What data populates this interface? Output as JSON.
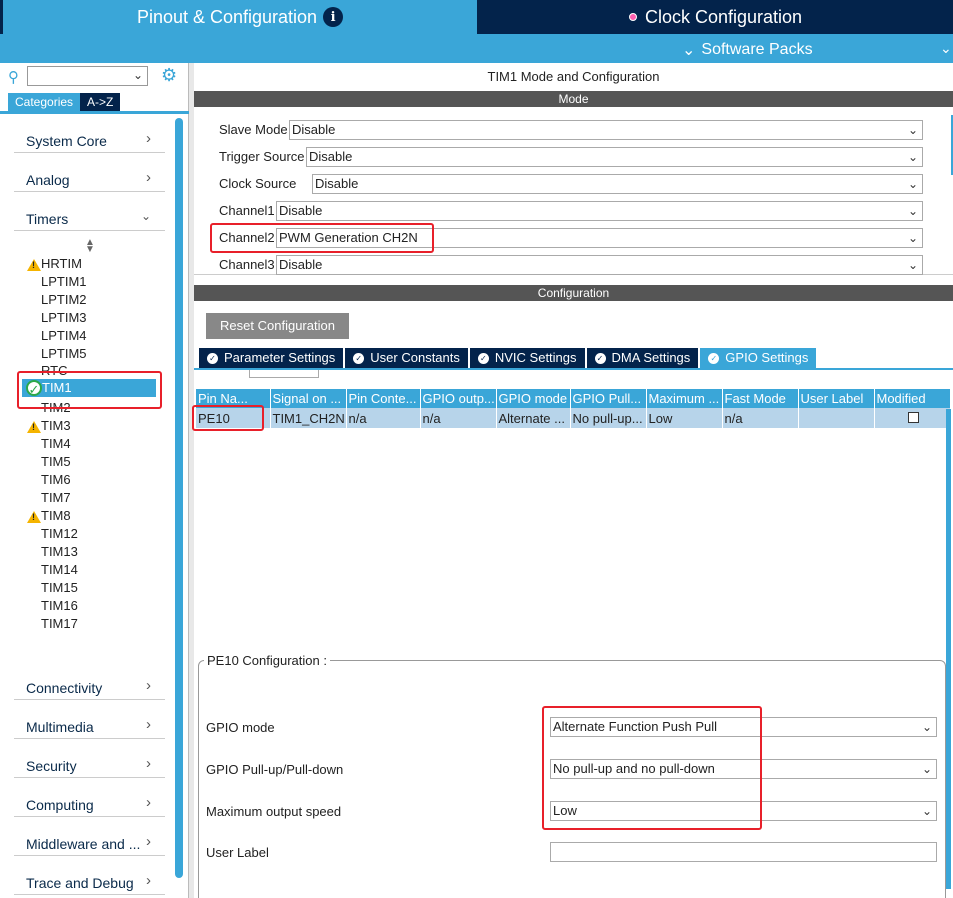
{
  "header": {
    "pinout_tab": "Pinout & Configuration",
    "clock_tab": "Clock Configuration",
    "software_packs": "Software Packs"
  },
  "sidebar": {
    "search": {
      "value": ""
    },
    "tabs": {
      "categories": "Categories",
      "az": "A->Z"
    },
    "categories_top": [
      "System Core",
      "Analog",
      "Timers"
    ],
    "timers": [
      "HRTIM",
      "LPTIM1",
      "LPTIM2",
      "LPTIM3",
      "LPTIM4",
      "LPTIM5",
      "RTC",
      "TIM1",
      "TIM2",
      "TIM3",
      "TIM4",
      "TIM5",
      "TIM6",
      "TIM7",
      "TIM8",
      "TIM12",
      "TIM13",
      "TIM14",
      "TIM15",
      "TIM16",
      "TIM17"
    ],
    "categories_bottom": [
      "Connectivity",
      "Multimedia",
      "Security",
      "Computing",
      "Middleware and ...",
      "Trace and Debug"
    ]
  },
  "main": {
    "title": "TIM1 Mode and Configuration",
    "mode_header": "Mode",
    "mode_fields": [
      {
        "label": "Slave Mode",
        "value": "Disable"
      },
      {
        "label": "Trigger Source",
        "value": "Disable"
      },
      {
        "label": "Clock Source",
        "value": "Disable"
      },
      {
        "label": "Channel1",
        "value": "Disable"
      },
      {
        "label": "Channel2",
        "value": "PWM Generation CH2N"
      },
      {
        "label": "Channel3",
        "value": "Disable"
      }
    ],
    "config_header": "Configuration",
    "reset_button": "Reset Configuration",
    "tabs": [
      "Parameter Settings",
      "User Constants",
      "NVIC Settings",
      "DMA Settings",
      "GPIO Settings"
    ],
    "table": {
      "columns": [
        "Pin Na...",
        "Signal on ...",
        "Pin Conte...",
        "GPIO outp...",
        "GPIO mode",
        "GPIO Pull...",
        "Maximum ...",
        "Fast Mode",
        "User Label",
        "Modified"
      ],
      "rows": [
        [
          "PE10",
          "TIM1_CH2N",
          "n/a",
          "n/a",
          "Alternate ...",
          "No pull-up...",
          "Low",
          "n/a",
          "",
          ""
        ]
      ]
    },
    "pin_config": {
      "legend": "PE10 Configuration :",
      "gpio_mode_label": "GPIO mode",
      "gpio_mode_value": "Alternate Function Push Pull",
      "pull_label": "GPIO Pull-up/Pull-down",
      "pull_value": "No pull-up and no pull-down",
      "speed_label": "Maximum output speed",
      "speed_value": "Low",
      "user_label_label": "User Label",
      "user_label_value": ""
    }
  }
}
